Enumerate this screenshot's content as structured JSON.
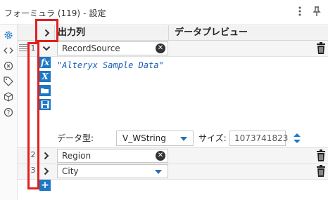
{
  "window": {
    "title": "フォーミュラ (119)",
    "subtitle": "設定",
    "menu_icon": "vertical-dots-icon",
    "pin_icon": "pin-icon"
  },
  "sidebar": {
    "icons": [
      "gear-icon",
      "code-icon",
      "close-circle-icon",
      "tag-icon",
      "cube-icon",
      "help-icon"
    ]
  },
  "grid": {
    "headers": {
      "output_column": "出力列",
      "data_preview": "データプレビュー"
    },
    "rows": [
      {
        "number": "1",
        "field": "RecordSource",
        "expression": "\"Alteryx Sample Data\"",
        "data_type_label": "データ型:",
        "data_type": "V_WString",
        "size_label": "サイズ:",
        "size": "1073741823"
      },
      {
        "number": "2",
        "field": "Region"
      },
      {
        "number": "3",
        "field": "City"
      }
    ],
    "tools": [
      "function-icon",
      "variable-icon",
      "open-folder-icon",
      "save-icon"
    ],
    "add_label": "+"
  },
  "colors": {
    "accent": "#1d78c5",
    "highlight": "#e02020"
  }
}
